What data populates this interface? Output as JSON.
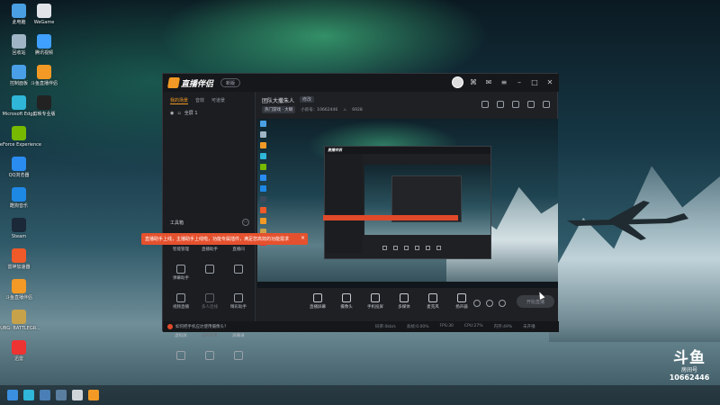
{
  "desktop": {
    "icons": [
      {
        "label": "此电脑",
        "icon": "computer-icon",
        "color": "#4a9fe3"
      },
      {
        "label": "WeGame",
        "icon": "wegame-icon",
        "color": "#e0e4e8"
      },
      {
        "label": "回收站",
        "icon": "recycle-bin-icon",
        "color": "#9fb5c5"
      },
      {
        "label": "腾讯视频",
        "icon": "tencent-video-icon",
        "color": "#3fa0ff"
      },
      {
        "label": "控制面板",
        "icon": "control-panel-icon",
        "color": "#4aa0e8"
      },
      {
        "label": "斗鱼直播伴侣",
        "icon": "douyu-companion-icon",
        "color": "#f29a25"
      },
      {
        "label": "Microsoft Edge",
        "icon": "edge-icon",
        "color": "#2fb6d8"
      },
      {
        "label": "剪映专业版",
        "icon": "jianying-icon",
        "color": "#222"
      },
      {
        "label": "GeForce Experience",
        "icon": "geforce-icon",
        "color": "#76b900"
      },
      {
        "label": "QQ浏览器",
        "icon": "qq-browser-icon",
        "color": "#2a8cf0"
      },
      {
        "label": "酷狗音乐",
        "icon": "kugou-icon",
        "color": "#1e88e5"
      },
      {
        "label": "Steam",
        "icon": "steam-icon",
        "color": "#1b2838"
      },
      {
        "label": "雷神加速器",
        "icon": "leishen-icon",
        "color": "#f05a28"
      },
      {
        "label": "斗鱼直播伴侣",
        "icon": "douyu-companion-icon",
        "color": "#f29a25"
      },
      {
        "label": "PUBG: BATTLEGR...",
        "icon": "pubg-icon",
        "color": "#c8a24a"
      },
      {
        "label": "迅雷",
        "icon": "xunlei-icon",
        "color": "#e33"
      }
    ]
  },
  "app": {
    "logo_text": "直播伴侣",
    "version_badge": "新版",
    "titlebar_icons": [
      "avatar",
      "gamepad-icon",
      "message-icon",
      "menu-icon",
      "minimize-icon",
      "maximize-icon",
      "close-icon"
    ],
    "left_tabs": [
      "我的场景",
      "音效",
      "可道景"
    ],
    "scene_item": "全屏 1",
    "tools_title": "工具箱",
    "tools_more": "···",
    "tools": [
      {
        "label": "智能管理",
        "dim": false
      },
      {
        "label": "直播助手",
        "dim": false
      },
      {
        "label": "直播间",
        "dim": false
      },
      {
        "label": "弹幕助手",
        "dim": false
      },
      {
        "label": "",
        "dim": false
      },
      {
        "label": "",
        "dim": false
      },
      {
        "label": "视频直播",
        "dim": false
      },
      {
        "label": "多人连线",
        "dim": true
      },
      {
        "label": "精彩助手",
        "dim": false
      },
      {
        "label": "虚拟屏",
        "dim": false
      },
      {
        "label": "虚拟形象",
        "dim": true
      },
      {
        "label": "屏幕录",
        "dim": false
      },
      {
        "label": "",
        "dim": false
      },
      {
        "label": "",
        "dim": false
      },
      {
        "label": "",
        "dim": false
      }
    ],
    "room_title": "团队大撒朱人",
    "edit_label": "修改",
    "category": "热门游戏 · 大喇",
    "room_label": "小房号：",
    "room_id": "10662446",
    "heat_value": "6928",
    "toast_text": "直播助手上线，主播助手上线啦，功能专属插件，满足您高效的功能需求",
    "toast_close": "×",
    "bottom_tools": [
      {
        "label": "直播屏幕"
      },
      {
        "label": "摄像头"
      },
      {
        "label": "手机投屏"
      },
      {
        "label": "多媒体"
      },
      {
        "label": "麦克风"
      },
      {
        "label": "扬声器"
      }
    ],
    "start_button": "开始直播",
    "status_tip": "如何把手机应达使用摄像头?",
    "status_stats": [
      "码率:0kb/s",
      "丢帧:0.00%",
      "FPS:30",
      "CPU:27%",
      "内存:49%",
      "未开播"
    ]
  },
  "taskbar": {
    "icons": [
      {
        "name": "windows-start-icon",
        "color": "#3b8fe0"
      },
      {
        "name": "edge-taskbar-icon",
        "color": "#2fb6d8"
      },
      {
        "name": "explorer-icon",
        "color": "#4a7fb5"
      },
      {
        "name": "steam-taskbar-icon",
        "color": "#5a7ea0"
      },
      {
        "name": "obs-icon",
        "color": "#cfd4d8"
      },
      {
        "name": "douyu-taskbar-icon",
        "color": "#f29a25"
      }
    ]
  },
  "watermark": {
    "logo": "斗鱼",
    "sub": "房间号",
    "id": "10662446"
  }
}
